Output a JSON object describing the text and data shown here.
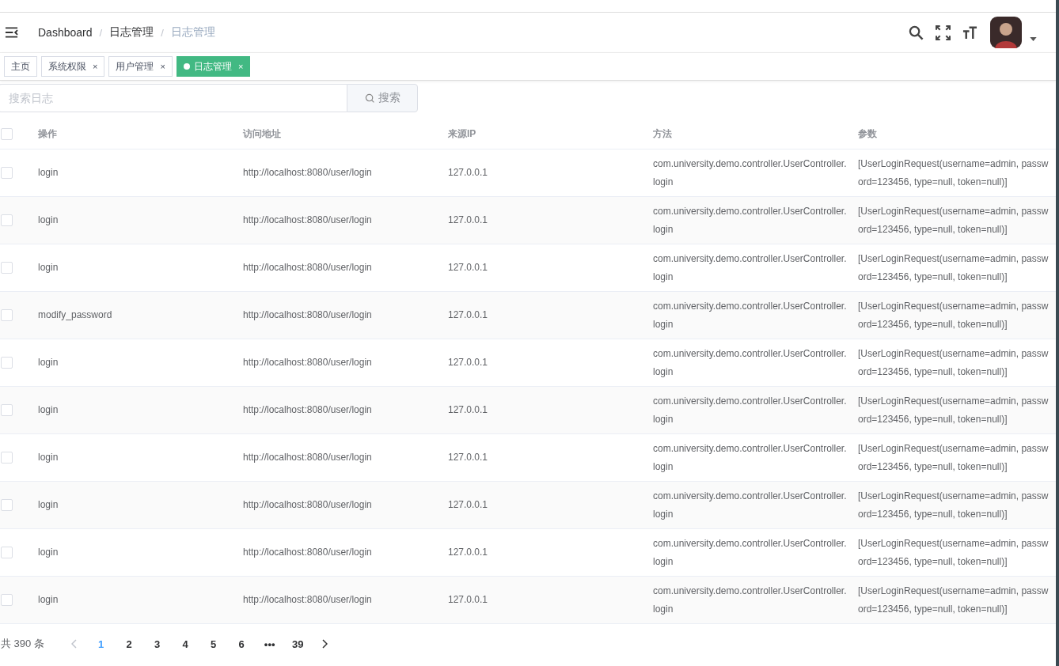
{
  "navbar": {
    "breadcrumb": [
      {
        "label": "Dashboard",
        "current": false
      },
      {
        "separator": "/",
        "label": "日志管理",
        "current": false
      },
      {
        "separator": "/",
        "label": "日志管理",
        "current": true
      }
    ]
  },
  "tags": [
    {
      "label": "主页",
      "selected": false
    },
    {
      "label": "系统权限",
      "selected": false,
      "close": "×"
    },
    {
      "label": "用户管理",
      "selected": false,
      "close": "×"
    },
    {
      "label": "日志管理",
      "selected": true,
      "close": "×"
    }
  ],
  "search": {
    "placeholder": "搜索日志",
    "button": "搜索"
  },
  "table": {
    "header_checked": false,
    "columns": [
      "操作",
      "访问地址",
      "来源IP",
      "方法",
      "参数"
    ],
    "rows": [
      {
        "checked": false,
        "cells": [
          "login",
          "http://localhost:8080/user/login",
          "127.0.0.1",
          "com.university.demo.controller.UserController.login",
          "[UserLoginRequest(username=admin, password=123456, type=null, token=null)]"
        ]
      },
      {
        "checked": false,
        "cells": [
          "login",
          "http://localhost:8080/user/login",
          "127.0.0.1",
          "com.university.demo.controller.UserController.login",
          "[UserLoginRequest(username=admin, password=123456, type=null, token=null)]"
        ]
      },
      {
        "checked": false,
        "cells": [
          "login",
          "http://localhost:8080/user/login",
          "127.0.0.1",
          "com.university.demo.controller.UserController.login",
          "[UserLoginRequest(username=admin, password=123456, type=null, token=null)]"
        ]
      },
      {
        "checked": false,
        "cells": [
          "modify_password",
          "http://localhost:8080/user/login",
          "127.0.0.1",
          "com.university.demo.controller.UserController.login",
          "[UserLoginRequest(username=admin, password=123456, type=null, token=null)]"
        ]
      },
      {
        "checked": false,
        "cells": [
          "login",
          "http://localhost:8080/user/login",
          "127.0.0.1",
          "com.university.demo.controller.UserController.login",
          "[UserLoginRequest(username=admin, password=123456, type=null, token=null)]"
        ]
      },
      {
        "checked": false,
        "cells": [
          "login",
          "http://localhost:8080/user/login",
          "127.0.0.1",
          "com.university.demo.controller.UserController.login",
          "[UserLoginRequest(username=admin, password=123456, type=null, token=null)]"
        ]
      },
      {
        "checked": false,
        "cells": [
          "login",
          "http://localhost:8080/user/login",
          "127.0.0.1",
          "com.university.demo.controller.UserController.login",
          "[UserLoginRequest(username=admin, password=123456, type=null, token=null)]"
        ]
      },
      {
        "checked": false,
        "cells": [
          "login",
          "http://localhost:8080/user/login",
          "127.0.0.1",
          "com.university.demo.controller.UserController.login",
          "[UserLoginRequest(username=admin, password=123456, type=null, token=null)]"
        ]
      },
      {
        "checked": false,
        "cells": [
          "login",
          "http://localhost:8080/user/login",
          "127.0.0.1",
          "com.university.demo.controller.UserController.login",
          "[UserLoginRequest(username=admin, password=123456, type=null, token=null)]"
        ]
      },
      {
        "checked": false,
        "cells": [
          "login",
          "http://localhost:8080/user/login",
          "127.0.0.1",
          "com.university.demo.controller.UserController.login",
          "[UserLoginRequest(username=admin, password=123456, type=null, token=null)]"
        ]
      }
    ]
  },
  "pagination": {
    "total": "共 390 条",
    "prev_disabled": true,
    "pages": [
      {
        "label": "1",
        "selected": true
      },
      {
        "label": "2",
        "selected": false
      },
      {
        "label": "3",
        "selected": false
      },
      {
        "label": "4",
        "selected": false
      },
      {
        "label": "5",
        "selected": false
      },
      {
        "label": "6",
        "selected": false
      },
      {
        "label": "•••",
        "selected": false
      },
      {
        "label": "39",
        "selected": false
      }
    ]
  }
}
